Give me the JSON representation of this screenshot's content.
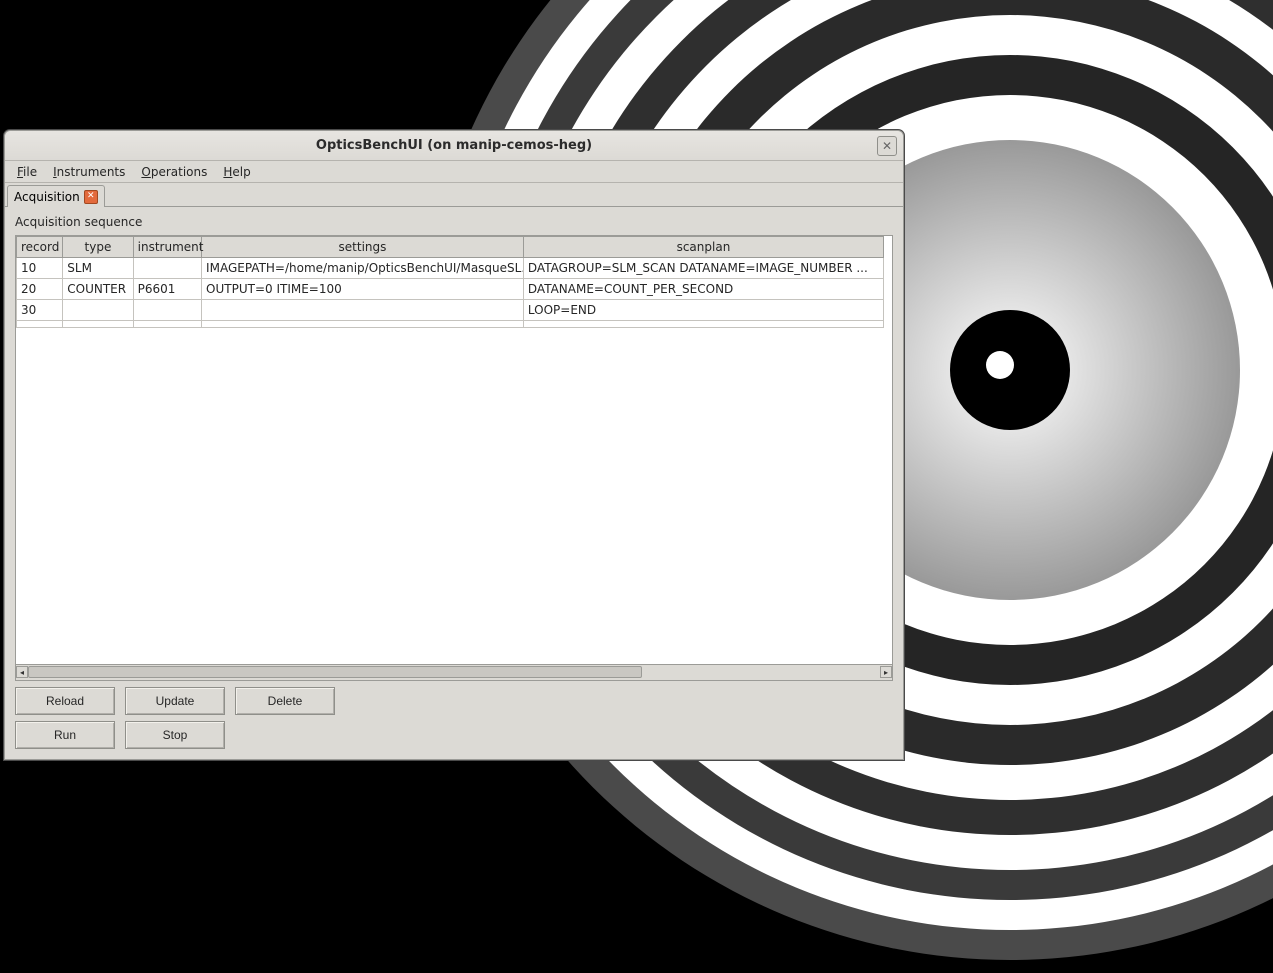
{
  "window": {
    "title": "OpticsBenchUI (on manip-cemos-heg)"
  },
  "menubar": {
    "file": "File",
    "instruments": "Instruments",
    "operations": "Operations",
    "help": "Help"
  },
  "tab": {
    "label": "Acquisition"
  },
  "section": {
    "label": "Acquisition sequence"
  },
  "table": {
    "headers": {
      "record": "record",
      "type": "type",
      "instrument": "instrument",
      "settings": "settings",
      "scanplan": "scanplan"
    },
    "rows": [
      {
        "record": "10",
        "type": "SLM",
        "instrument": "",
        "settings": "IMAGEPATH=/home/manip/OpticsBenchUI/MasqueSL...",
        "scanplan": "DATAGROUP=SLM_SCAN  DATANAME=IMAGE_NUMBER ..."
      },
      {
        "record": "20",
        "type": "COUNTER",
        "instrument": "P6601",
        "settings": "OUTPUT=0 ITIME=100",
        "scanplan": "DATANAME=COUNT_PER_SECOND"
      },
      {
        "record": "30",
        "type": "",
        "instrument": "",
        "settings": "",
        "scanplan": "LOOP=END"
      },
      {
        "record": "",
        "type": "",
        "instrument": "",
        "settings": "",
        "scanplan": ""
      }
    ]
  },
  "buttons": {
    "reload": "Reload",
    "update": "Update",
    "delete": "Delete",
    "run": "Run",
    "stop": "Stop"
  }
}
